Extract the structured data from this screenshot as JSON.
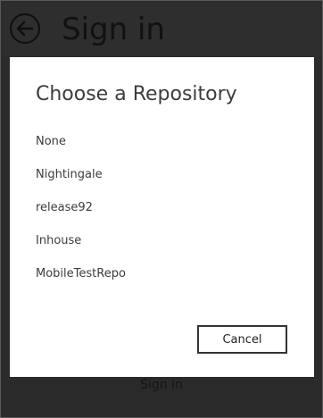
{
  "background": {
    "title": "Sign in",
    "bottom_button": "Sign in",
    "back_icon": "back-arrow-circle-icon"
  },
  "dialog": {
    "title": "Choose a Repository",
    "repositories": [
      "None",
      "Nightingale",
      "release92",
      "Inhouse",
      "MobileTestRepo"
    ],
    "cancel_label": "Cancel"
  }
}
